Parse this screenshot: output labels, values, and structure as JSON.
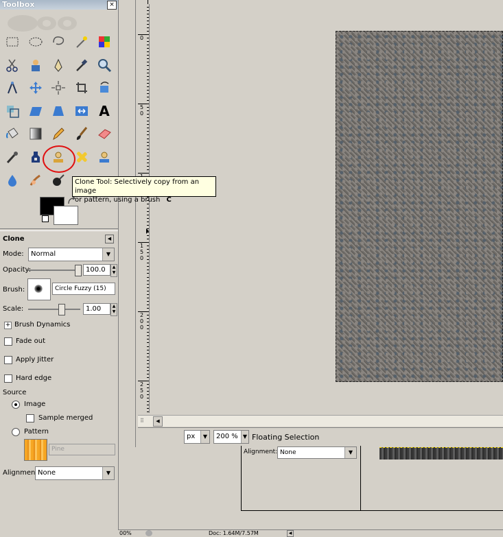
{
  "toolbox": {
    "title": "Toolbox",
    "close_glyph": "×",
    "tools": [
      {
        "name": "rect-select-icon"
      },
      {
        "name": "ellipse-select-icon"
      },
      {
        "name": "lasso-icon"
      },
      {
        "name": "fuzzy-select-icon"
      },
      {
        "name": "color-select-icon"
      },
      {
        "name": "scissors-icon"
      },
      {
        "name": "foreground-select-icon"
      },
      {
        "name": "paths-icon"
      },
      {
        "name": "color-picker-icon"
      },
      {
        "name": "zoom-icon"
      },
      {
        "name": "measure-icon"
      },
      {
        "name": "move-icon"
      },
      {
        "name": "align-icon"
      },
      {
        "name": "crop-icon"
      },
      {
        "name": "rotate-icon"
      },
      {
        "name": "scale-icon"
      },
      {
        "name": "shear-icon"
      },
      {
        "name": "perspective-icon"
      },
      {
        "name": "flip-icon"
      },
      {
        "name": "text-icon",
        "glyph": "A"
      },
      {
        "name": "bucket-fill-icon"
      },
      {
        "name": "blend-icon"
      },
      {
        "name": "pencil-icon"
      },
      {
        "name": "paintbrush-icon"
      },
      {
        "name": "eraser-icon"
      },
      {
        "name": "airbrush-icon"
      },
      {
        "name": "ink-icon"
      },
      {
        "name": "clone-icon"
      },
      {
        "name": "heal-icon"
      },
      {
        "name": "perspective-clone-icon"
      },
      {
        "name": "blur-icon"
      },
      {
        "name": "smudge-icon"
      },
      {
        "name": "dodge-burn-icon"
      }
    ]
  },
  "tooltip": {
    "line1": "Clone Tool: Selectively copy from an image",
    "line2": "or pattern, using a brush",
    "shortcut": "C"
  },
  "options": {
    "title": "Clone",
    "mode_label": "Mode:",
    "mode_value": "Normal",
    "opacity_label": "Opacity:",
    "opacity_value": "100.0",
    "opacity_level": 1.0,
    "brush_label": "Brush:",
    "brush_value": "Circle Fuzzy (15)",
    "scale_label": "Scale:",
    "scale_value": "1.00",
    "brush_dynamics": "Brush Dynamics",
    "expand_glyph": "+",
    "fade_out": "Fade out",
    "apply_jitter": "Apply Jitter",
    "hard_edge": "Hard edge",
    "source_label": "Source",
    "source_image": "Image",
    "sample_merged": "Sample merged",
    "source_pattern": "Pattern",
    "pattern_name": "Pine",
    "alignment_label": "Alignment:",
    "alignment_value": "None"
  },
  "image_window": {
    "ruler_ticks": [
      {
        "label": "0",
        "digits": [
          "0"
        ]
      },
      {
        "label": "50",
        "digits": [
          "5",
          "0"
        ]
      },
      {
        "label": "100",
        "digits": [
          "1"
        ]
      },
      {
        "label": "150",
        "digits": [
          "1",
          "5",
          "0"
        ]
      },
      {
        "label": "200",
        "digits": [
          "2",
          "0",
          "0"
        ]
      },
      {
        "label": "250",
        "digits": [
          "2",
          "5",
          "0"
        ]
      }
    ],
    "unit": "px",
    "zoom": "200 %",
    "status": "Floating Selection"
  },
  "lower_dialog": {
    "alignment_label": "Alignment:",
    "alignment_value": "None"
  },
  "bottom_bar": {
    "zoom": "00%",
    "doc": "Doc: 1.64M/7.57M"
  }
}
